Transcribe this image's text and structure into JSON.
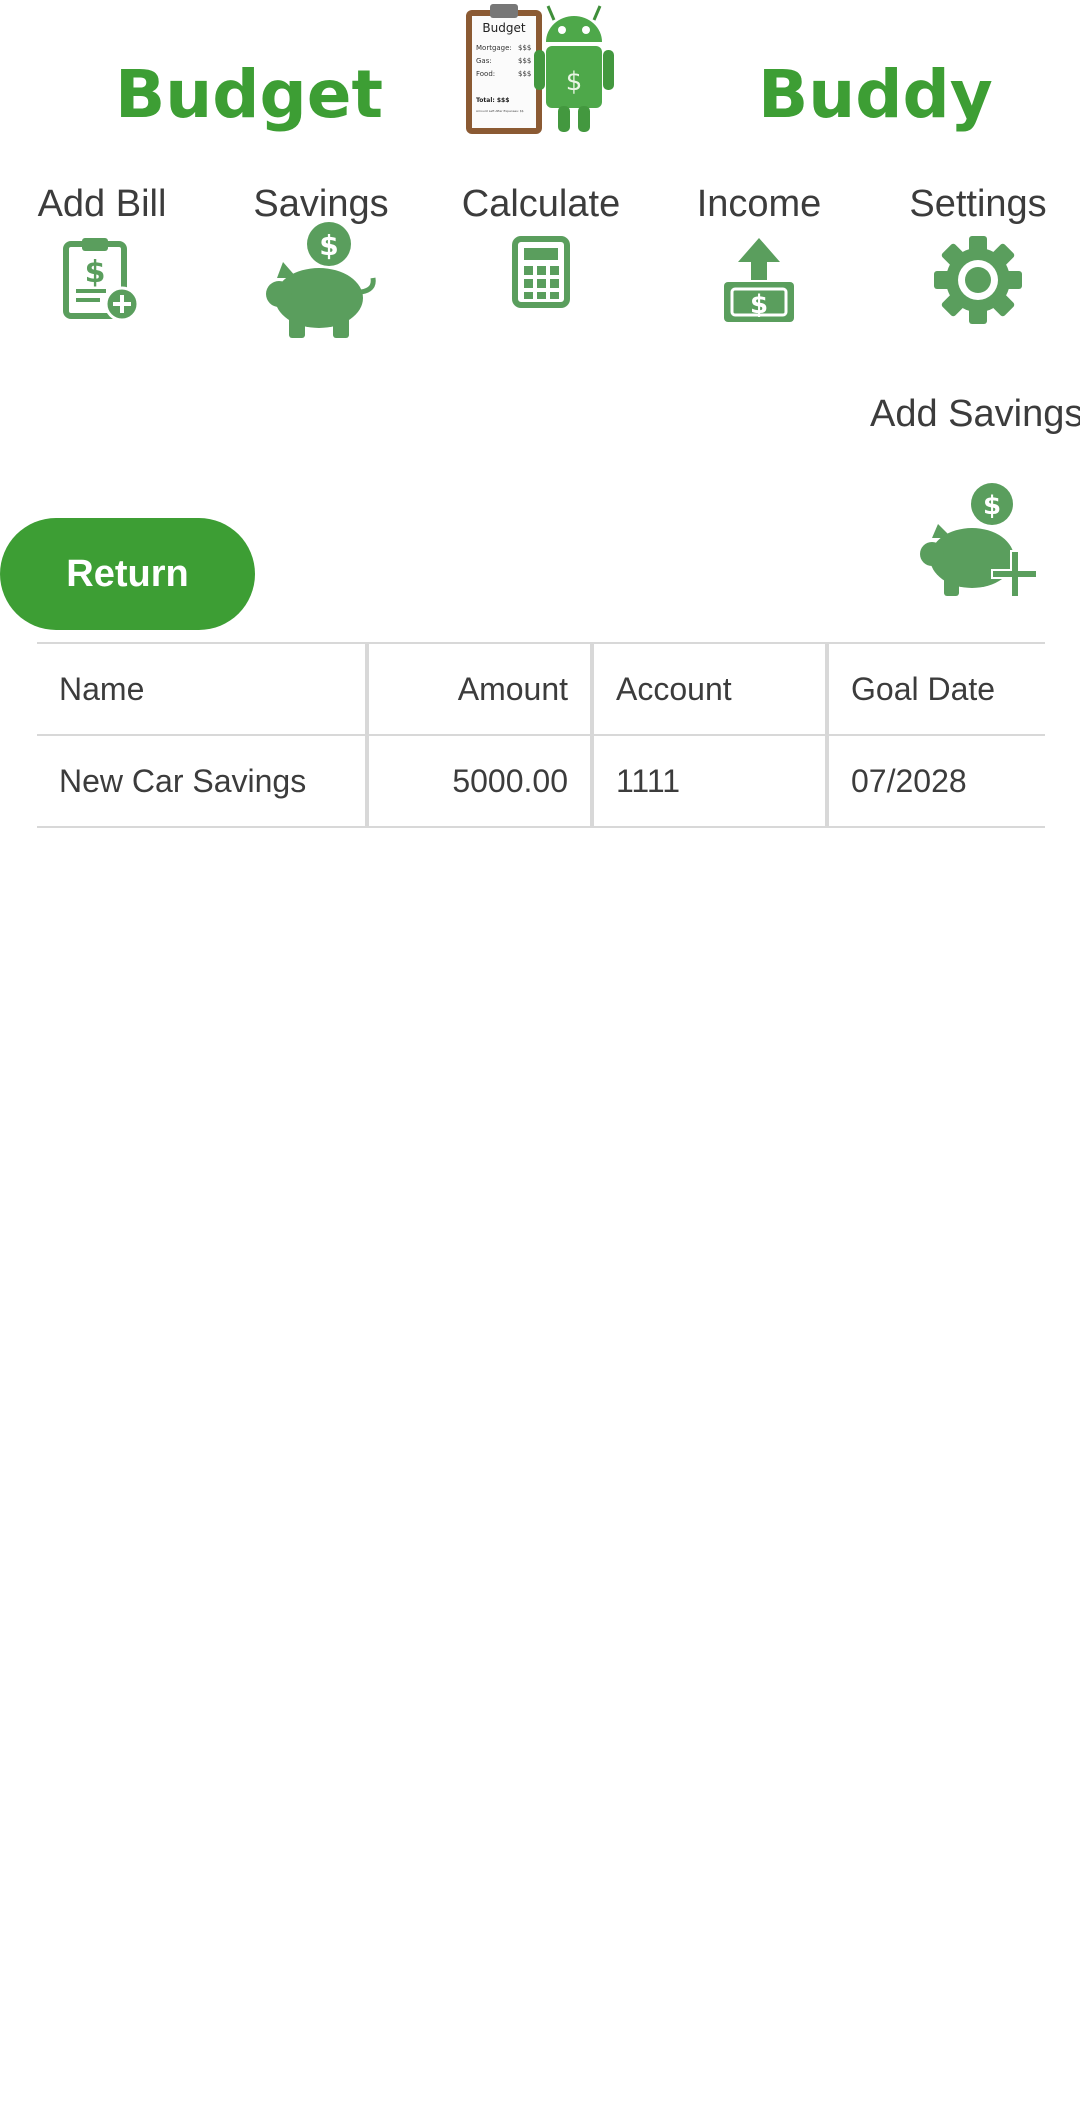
{
  "header": {
    "title_left": "Budget",
    "title_right": "Buddy",
    "logo": {
      "clipboard_title": "Budget",
      "lines": [
        {
          "label": "Mortgage:",
          "value": "$$$"
        },
        {
          "label": "Gas:",
          "value": "$$$"
        },
        {
          "label": "Food:",
          "value": "$$$"
        }
      ],
      "total": "Total: $$$",
      "footnote": "Amount Left After Expenses: $$",
      "robot_symbol": "$"
    }
  },
  "nav": [
    {
      "label": "Add Bill",
      "icon": "bill-add-icon"
    },
    {
      "label": "Savings",
      "icon": "piggy-bank-icon"
    },
    {
      "label": "Calculate",
      "icon": "calculator-icon"
    },
    {
      "label": "Income",
      "icon": "income-icon"
    },
    {
      "label": "Settings",
      "icon": "gear-icon"
    }
  ],
  "actions": {
    "add_savings_label": "Add Savings",
    "return_label": "Return"
  },
  "table": {
    "headers": [
      "Name",
      "Amount",
      "Account",
      "Goal Date"
    ],
    "rows": [
      [
        "New Car Savings",
        "5000.00",
        "1111",
        "07/2028"
      ]
    ]
  },
  "colors": {
    "brand_green": "#3d9e34",
    "icon_green": "#5a9e5d",
    "text": "#3c3c3c"
  }
}
